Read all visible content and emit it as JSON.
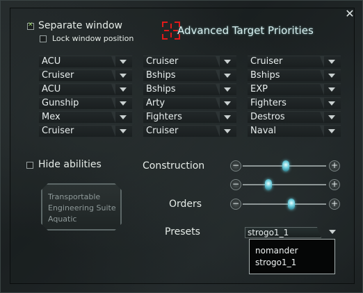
{
  "window": {
    "title": "Advanced Target Priorities",
    "close_label": "✕"
  },
  "options": {
    "separate_window": {
      "label": "Separate window",
      "checked": true
    },
    "lock_position": {
      "label": "Lock window position",
      "checked": false
    },
    "hide_abilities": {
      "label": "Hide abilities",
      "checked": false
    }
  },
  "priorities": {
    "columns": [
      [
        "ACU",
        "Cruiser",
        "ACU",
        "Gunship",
        "Mex",
        "Cruiser"
      ],
      [
        "Cruiser",
        "Bships",
        "Bships",
        "Arty",
        "Fighters",
        "Cruiser"
      ],
      [
        "Cruiser",
        "Bships",
        "EXP",
        "Fighters",
        "Destros",
        "Naval"
      ]
    ]
  },
  "abilities": {
    "lines": [
      "Transportable",
      "Engineering Suite",
      "Aquatic"
    ]
  },
  "sliders": {
    "construction_label": "Construction",
    "orders_label": "Orders",
    "minus_label": "−",
    "plus_label": "+",
    "construction_1_value": 0.52,
    "construction_2_value": 0.31,
    "orders_value": 0.58
  },
  "presets": {
    "label": "Presets",
    "selected": "strogo1_1",
    "options": [
      "nomander",
      "strogo1_1"
    ]
  },
  "colors": {
    "accent_check": "#9ad36a",
    "title_icon": "#e11a1a",
    "slider_thumb": "#66c8d8"
  }
}
